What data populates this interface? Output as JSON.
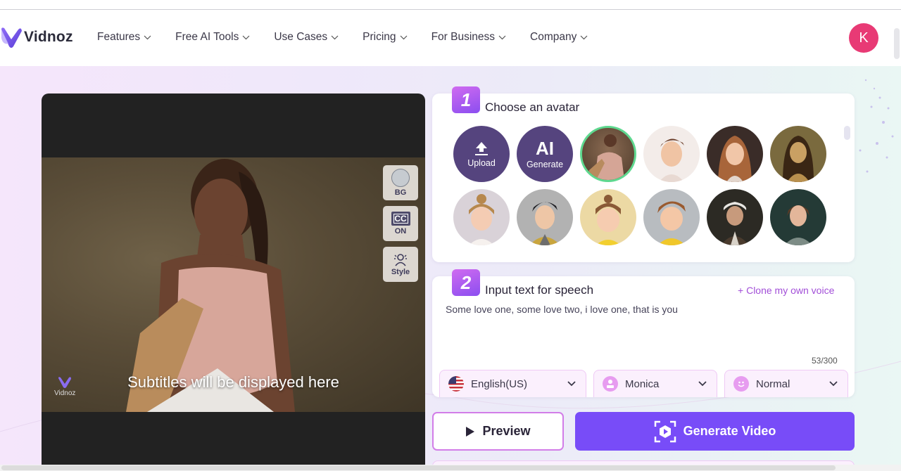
{
  "brand": {
    "name": "Vidnoz",
    "accent": "#784cf8",
    "avatar_initial": "K",
    "avatar_color": "#e83a75"
  },
  "nav": {
    "items": [
      {
        "label": "Features"
      },
      {
        "label": "Free AI Tools"
      },
      {
        "label": "Use Cases"
      },
      {
        "label": "Pricing"
      },
      {
        "label": "For Business"
      },
      {
        "label": "Company"
      }
    ]
  },
  "video": {
    "tools": [
      {
        "label": "BG",
        "icon": "background-circle-icon"
      },
      {
        "label": "ON",
        "icon": "closed-captions-icon",
        "glyph": "CC"
      },
      {
        "label": "Style",
        "icon": "avatar-style-icon"
      }
    ],
    "subtitle": "Subtitles will be displayed here",
    "watermark": "Vidnoz"
  },
  "step1": {
    "number": "1",
    "title": "Choose an avatar",
    "upload_label": "Upload",
    "ai_big": "AI",
    "ai_label": "Generate",
    "avatars": [
      {
        "name": "Woman with yoga mat",
        "selected": true
      },
      {
        "name": "Cartoon man in sweater",
        "selected": false
      },
      {
        "name": "Cartoon woman with long hair",
        "selected": false
      },
      {
        "name": "Mona Lisa",
        "selected": false
      },
      {
        "name": "Cartoon woman with bun",
        "selected": false
      },
      {
        "name": "Cartoon boy with black hair",
        "selected": false
      },
      {
        "name": "Cartoon girl in yellow",
        "selected": false
      },
      {
        "name": "Cartoon boy in yellow jacket",
        "selected": false
      },
      {
        "name": "Elderly professor",
        "selected": false
      },
      {
        "name": "Woman teacher",
        "selected": false
      }
    ]
  },
  "step2": {
    "number": "2",
    "title": "Input text for speech",
    "clone_link": "Clone my own voice",
    "text": "Some love one, some love two, i love one, that is you",
    "counter": "53/300",
    "language": "English(US)",
    "voice": "Monica",
    "emotion": "Normal"
  },
  "actions": {
    "preview": "Preview",
    "generate": "Generate Video"
  }
}
